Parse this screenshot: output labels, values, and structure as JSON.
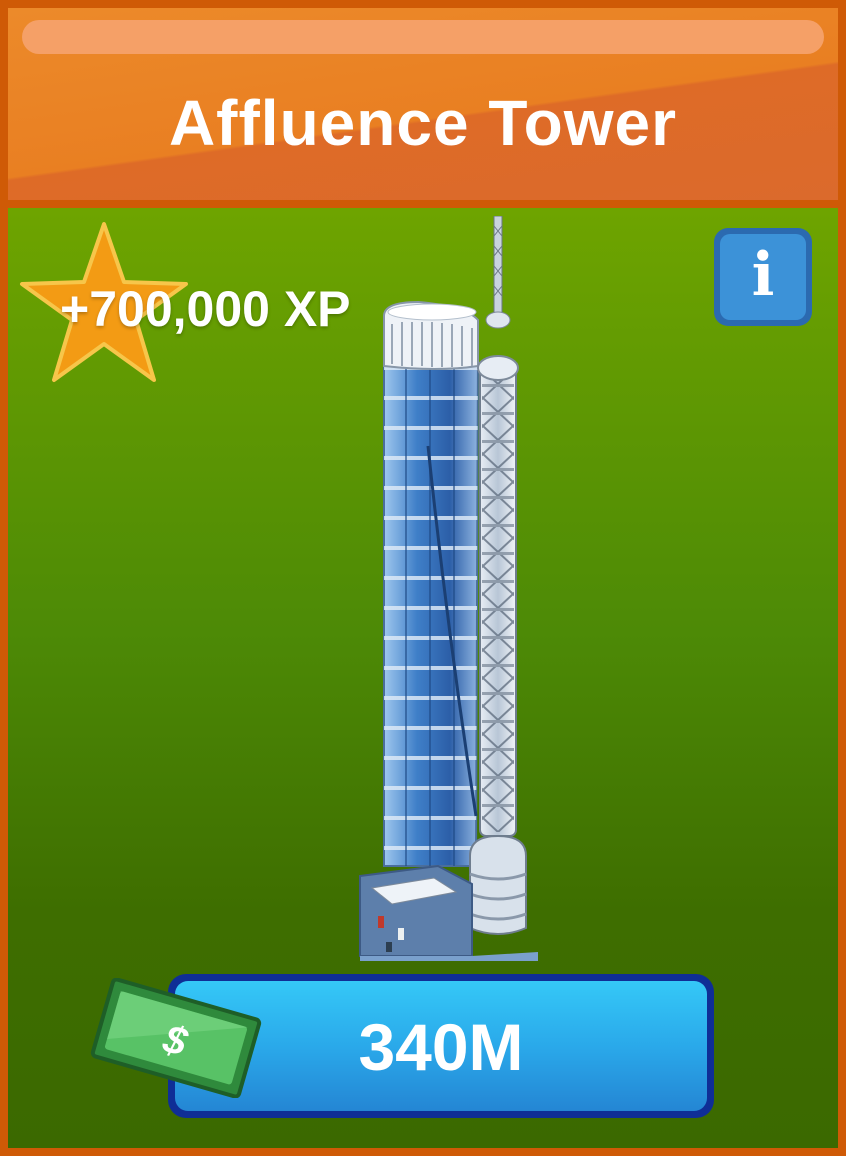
{
  "header": {
    "title": "Affluence Tower"
  },
  "reward": {
    "xp_label": "+700,000 XP",
    "icon": "star-icon"
  },
  "info": {
    "icon": "info-icon",
    "glyph": "i"
  },
  "building": {
    "icon": "skyscraper-illustration"
  },
  "purchase": {
    "price_label": "340M",
    "currency_symbol": "$",
    "icon": "cash-icon"
  },
  "colors": {
    "header_orange": "#e98426",
    "body_green_top": "#6ea400",
    "body_green_bottom": "#3b6900",
    "border_orange": "#cf5a06",
    "button_blue": "#2aa9ea",
    "button_border": "#0f2e96",
    "star_orange": "#f39b14",
    "info_blue": "#3c92d8"
  }
}
